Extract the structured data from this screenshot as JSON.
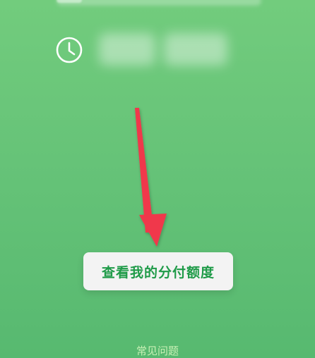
{
  "icons": {
    "clock": "clock-icon"
  },
  "colors": {
    "background_top": "#72cc7d",
    "background_bottom": "#57b970",
    "button_bg": "#f3f3f3",
    "button_text": "#1f9b48",
    "arrow": "#f0394b",
    "faq_text": "#c9f0b5"
  },
  "main": {
    "quota_button_label": "查看我的分付额度"
  },
  "footer": {
    "faq_label": "常见问题"
  }
}
